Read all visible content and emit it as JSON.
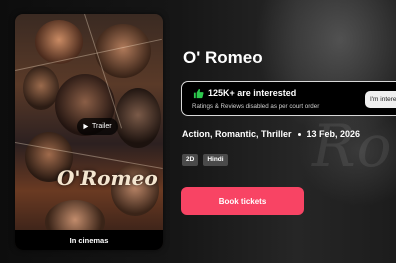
{
  "movie": {
    "title": "O' Romeo",
    "poster_logo": "O'Romeo",
    "poster_footer": "In cinemas",
    "trailer_label": "Trailer"
  },
  "interest": {
    "count_text": "125K+ are interested",
    "note": "Ratings & Reviews disabled as per court order",
    "button_label": "I'm interested"
  },
  "meta": {
    "genres": "Action, Romantic, Thriller",
    "release_date": "13 Feb, 2026"
  },
  "tags": [
    "2D",
    "Hindi"
  ],
  "cta": {
    "book_label": "Book tickets"
  },
  "backdrop_text": "Rom",
  "colors": {
    "accent": "#f84464",
    "thumb": "#2dc84d",
    "badge": "#4a4a4a"
  },
  "icons": {
    "interest": "thumbs-up-icon",
    "trailer": "play-icon"
  }
}
